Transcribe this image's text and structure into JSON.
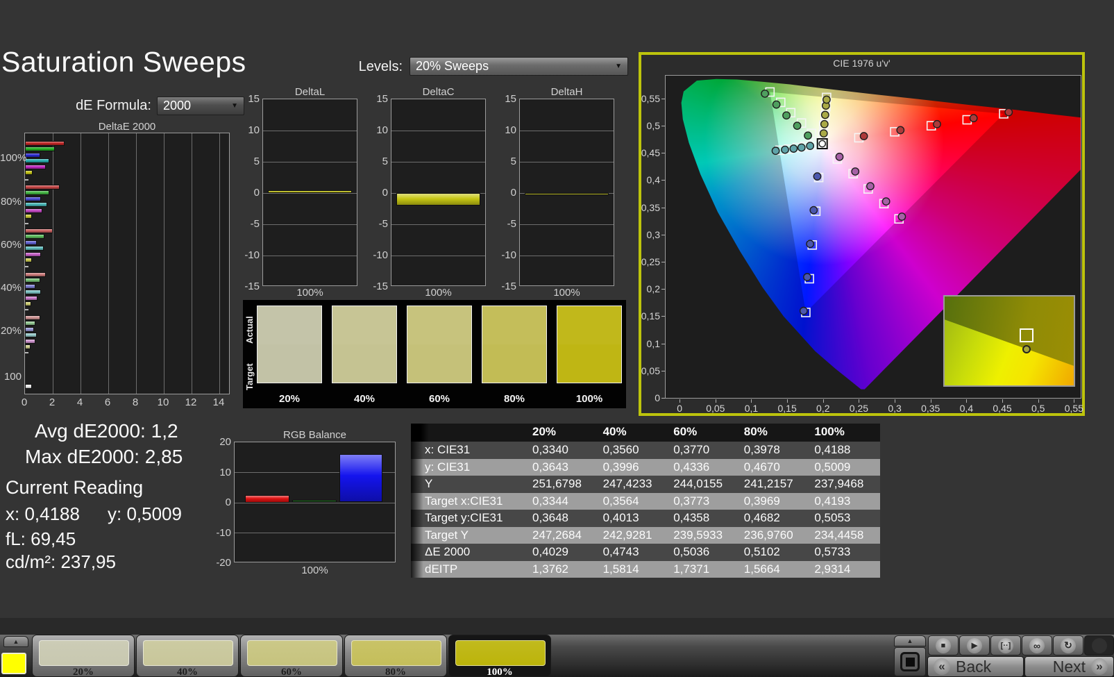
{
  "title": "Saturation Sweeps",
  "controls": {
    "de_formula": {
      "label": "dE Formula:",
      "value": "2000"
    },
    "levels": {
      "label": "Levels:",
      "value": "20% Sweeps"
    }
  },
  "stats": {
    "avg": "Avg dE2000: 1,2",
    "max": "Max dE2000: 2,85",
    "current_reading_label": "Current Reading",
    "x": "x: 0,4188",
    "y": "y: 0,5009",
    "fl": "fL: 69,45",
    "cdm2": "cd/m²: 237,95"
  },
  "swatch_strip": {
    "row_labels": [
      "Actual",
      "Target"
    ],
    "labels": [
      "20%",
      "40%",
      "60%",
      "80%",
      "100%"
    ],
    "colors": [
      "#c2c2a6",
      "#c5c392",
      "#c5c179",
      "#c2bc55",
      "#bfb614"
    ]
  },
  "chart_data": [
    {
      "id": "deltae2000",
      "type": "bar",
      "orientation": "horizontal",
      "title": "DeltaE 2000",
      "groups": [
        "100%",
        "80%",
        "60%",
        "40%",
        "20%",
        "100"
      ],
      "series_order": [
        "red",
        "green",
        "blue",
        "cyan",
        "magenta",
        "yellow"
      ],
      "series_colors": {
        "red": "#c22626",
        "green": "#22b022",
        "blue": "#2a2ad0",
        "cyan": "#28b0b0",
        "magenta": "#c028c0",
        "yellow": "#c6c614",
        "white": "#f2f2f2"
      },
      "values": {
        "100%": {
          "red": 2.85,
          "green": 2.15,
          "blue": 1.08,
          "cyan": 1.75,
          "magenta": 1.5,
          "yellow": 0.57
        },
        "80%": {
          "red": 2.5,
          "green": 1.75,
          "blue": 1.15,
          "cyan": 1.58,
          "magenta": 1.25,
          "yellow": 0.51
        },
        "60%": {
          "red": 2.0,
          "green": 1.42,
          "blue": 0.85,
          "cyan": 1.33,
          "magenta": 1.15,
          "yellow": 0.5
        },
        "40%": {
          "red": 1.5,
          "green": 1.08,
          "blue": 0.75,
          "cyan": 1.15,
          "magenta": 0.92,
          "yellow": 0.47
        },
        "20%": {
          "red": 1.08,
          "green": 0.75,
          "blue": 0.67,
          "cyan": 0.83,
          "magenta": 0.75,
          "yellow": 0.42
        },
        "100": {
          "white": 0.5
        }
      },
      "xlim": [
        0,
        14
      ],
      "xticks": [
        "0",
        "2",
        "4",
        "6",
        "8",
        "10",
        "12",
        "14"
      ]
    },
    {
      "id": "deltaL",
      "type": "bar",
      "title": "DeltaL",
      "category": "100%",
      "value": 0.4,
      "ylim": [
        -15,
        15
      ],
      "yticks": [
        "15",
        "10",
        "5",
        "0",
        "-5",
        "-10",
        "-15"
      ],
      "bar_color": "#c6c614"
    },
    {
      "id": "deltaC",
      "type": "bar",
      "title": "DeltaC",
      "category": "100%",
      "value": -2.0,
      "ylim": [
        -15,
        15
      ],
      "yticks": [
        "15",
        "10",
        "5",
        "0",
        "-5",
        "-10",
        "-15"
      ],
      "bar_color": "#c6c614"
    },
    {
      "id": "deltaH",
      "type": "bar",
      "title": "DeltaH",
      "category": "100%",
      "value": -0.35,
      "ylim": [
        -15,
        15
      ],
      "yticks": [
        "15",
        "10",
        "5",
        "0",
        "-5",
        "-10",
        "-15"
      ],
      "bar_color": "#c6c614"
    },
    {
      "id": "rgb_balance",
      "type": "bar",
      "title": "RGB Balance",
      "xlabel": "100%",
      "categories": [
        "red",
        "green",
        "blue"
      ],
      "values": [
        2.5,
        0.7,
        16
      ],
      "colors": [
        "#e01212",
        "#0d7c0d",
        "#1414ee"
      ],
      "ylim": [
        -20,
        20
      ],
      "yticks": [
        "20",
        "10",
        "0",
        "-10",
        "-20"
      ]
    },
    {
      "id": "cie1976",
      "type": "scatter",
      "title": "CIE 1976 u'v'",
      "xticks": [
        "0",
        "0,05",
        "0,1",
        "0,15",
        "0,2",
        "0,25",
        "0,3",
        "0,35",
        "0,4",
        "0,45",
        "0,5",
        "0,55"
      ],
      "yticks": [
        "0,55",
        "0,5",
        "0,45",
        "0,4",
        "0,35",
        "0,3",
        "0,25",
        "0,2",
        "0,15",
        "0,1",
        "0,05",
        "0"
      ],
      "xlim": [
        0,
        0.55
      ],
      "ylim": [
        0,
        0.55
      ],
      "white_point": {
        "target": [
          0.198,
          0.468
        ],
        "measured": [
          0.198,
          0.468
        ]
      },
      "gamut_triangle": [
        [
          0.451,
          0.523
        ],
        [
          0.125,
          0.563
        ],
        [
          0.175,
          0.158
        ]
      ],
      "series": [
        {
          "name": "red",
          "color": "#ad3a3a",
          "targets": [
            [
              0.249,
              0.479
            ],
            [
              0.299,
              0.49
            ],
            [
              0.35,
              0.501
            ],
            [
              0.4,
              0.512
            ],
            [
              0.451,
              0.523
            ]
          ],
          "measured": [
            [
              0.256,
              0.482
            ],
            [
              0.307,
              0.493
            ],
            [
              0.358,
              0.504
            ],
            [
              0.409,
              0.515
            ],
            [
              0.458,
              0.526
            ]
          ]
        },
        {
          "name": "green",
          "color": "#4f9f5f",
          "targets": [
            [
              0.183,
              0.487
            ],
            [
              0.169,
              0.506
            ],
            [
              0.154,
              0.525
            ],
            [
              0.14,
              0.544
            ],
            [
              0.125,
              0.563
            ]
          ],
          "measured": [
            [
              0.178,
              0.483
            ],
            [
              0.163,
              0.501
            ],
            [
              0.148,
              0.52
            ],
            [
              0.134,
              0.54
            ],
            [
              0.118,
              0.56
            ]
          ]
        },
        {
          "name": "blue",
          "color": "#4b57ae",
          "targets": [
            [
              0.193,
              0.406
            ],
            [
              0.189,
              0.344
            ],
            [
              0.184,
              0.282
            ],
            [
              0.18,
              0.22
            ],
            [
              0.175,
              0.158
            ]
          ],
          "measured": [
            [
              0.191,
              0.408
            ],
            [
              0.186,
              0.346
            ],
            [
              0.181,
              0.284
            ],
            [
              0.177,
              0.223
            ],
            [
              0.172,
              0.161
            ]
          ]
        },
        {
          "name": "cyan",
          "color": "#5fa3a8",
          "targets": [
            [
              0.186,
              0.466
            ],
            [
              0.174,
              0.463
            ],
            [
              0.163,
              0.461
            ],
            [
              0.151,
              0.458
            ],
            [
              0.139,
              0.456
            ]
          ],
          "measured": [
            [
              0.181,
              0.464
            ],
            [
              0.169,
              0.461
            ],
            [
              0.158,
              0.459
            ],
            [
              0.146,
              0.457
            ],
            [
              0.133,
              0.455
            ]
          ]
        },
        {
          "name": "magenta",
          "color": "#a661a6",
          "targets": [
            [
              0.219,
              0.44
            ],
            [
              0.241,
              0.413
            ],
            [
              0.262,
              0.385
            ],
            [
              0.284,
              0.358
            ],
            [
              0.305,
              0.33
            ]
          ],
          "measured": [
            [
              0.222,
              0.444
            ],
            [
              0.244,
              0.417
            ],
            [
              0.265,
              0.39
            ],
            [
              0.287,
              0.362
            ],
            [
              0.309,
              0.334
            ]
          ]
        },
        {
          "name": "yellow",
          "color": "#aaaa46",
          "targets": [
            [
              0.199,
              0.485
            ],
            [
              0.2,
              0.502
            ],
            [
              0.202,
              0.519
            ],
            [
              0.203,
              0.536
            ],
            [
              0.204,
              0.553
            ]
          ],
          "measured": [
            [
              0.2,
              0.487
            ],
            [
              0.201,
              0.504
            ],
            [
              0.202,
              0.521
            ],
            [
              0.203,
              0.538
            ],
            [
              0.204,
              0.549
            ]
          ]
        }
      ]
    }
  ],
  "table": {
    "columns": [
      "",
      "20%",
      "40%",
      "60%",
      "80%",
      "100%"
    ],
    "rows": [
      {
        "label": "x: CIE31",
        "values": [
          "0,3340",
          "0,3560",
          "0,3770",
          "0,3978",
          "0,4188"
        ]
      },
      {
        "label": "y: CIE31",
        "values": [
          "0,3643",
          "0,3996",
          "0,4336",
          "0,4670",
          "0,5009"
        ]
      },
      {
        "label": "Y",
        "values": [
          "251,6798",
          "247,4233",
          "244,0155",
          "241,2157",
          "237,9468"
        ]
      },
      {
        "label": "Target x:CIE31",
        "values": [
          "0,3344",
          "0,3564",
          "0,3773",
          "0,3969",
          "0,4193"
        ]
      },
      {
        "label": "Target y:CIE31",
        "values": [
          "0,3648",
          "0,4013",
          "0,4358",
          "0,4682",
          "0,5053"
        ]
      },
      {
        "label": "Target Y",
        "values": [
          "247,2684",
          "242,9281",
          "239,5933",
          "236,9760",
          "234,4458"
        ]
      },
      {
        "label": "ΔE 2000",
        "values": [
          "0,4029",
          "0,4743",
          "0,5036",
          "0,5102",
          "0,5733"
        ]
      },
      {
        "label": "dEITP",
        "values": [
          "1,3762",
          "1,5814",
          "1,7371",
          "1,5664",
          "2,9314"
        ]
      }
    ]
  },
  "bottom_bar": {
    "corner_swatch_color": "#ffff00",
    "swatches": [
      {
        "label": "20%",
        "color": "#c8c8b0",
        "selected": false
      },
      {
        "label": "40%",
        "color": "#c8c69a",
        "selected": false
      },
      {
        "label": "60%",
        "color": "#c6c37e",
        "selected": false
      },
      {
        "label": "80%",
        "color": "#c4be5a",
        "selected": false
      },
      {
        "label": "100%",
        "color": "#bcb40a",
        "selected": true
      }
    ],
    "icons": [
      {
        "name": "stop",
        "glyph": "■"
      },
      {
        "name": "play",
        "glyph": "▶"
      },
      {
        "name": "marker",
        "glyph": "[··]"
      },
      {
        "name": "infinity",
        "glyph": "∞"
      },
      {
        "name": "refresh",
        "glyph": "↻"
      }
    ],
    "nav": {
      "back_label": "Back",
      "next_label": "Next",
      "back_chevron": "«",
      "next_chevron": "»"
    }
  }
}
